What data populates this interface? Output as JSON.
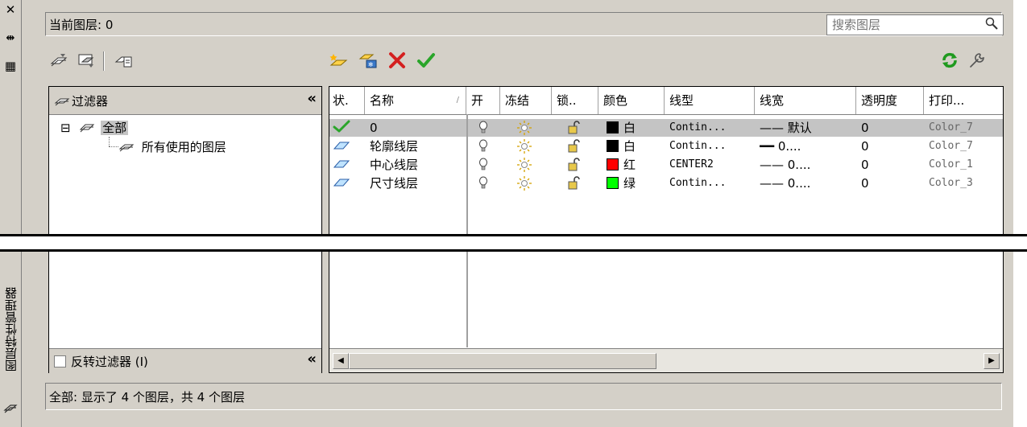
{
  "window": {
    "vertical_title": "图层特性管理器",
    "close_glyph": "✕",
    "autohide_glyph": "⇹",
    "props_glyph": "▦"
  },
  "current_layer": {
    "label": "当前图层: 0"
  },
  "search": {
    "placeholder": "搜索图层"
  },
  "filter_pane": {
    "header": "过滤器",
    "collapse_glyph": "«",
    "tree": [
      {
        "label": "全部",
        "expander": "⊟",
        "selected": true
      },
      {
        "label": "所有使用的图层"
      }
    ],
    "invert_label": "反转过滤器 (I)"
  },
  "table": {
    "columns": [
      "状.",
      "名称",
      "开",
      "冻结",
      "锁..",
      "颜色",
      "线型",
      "线宽",
      "透明度",
      "打印..."
    ],
    "rows": [
      {
        "status": "current",
        "name": "0",
        "color_name": "白",
        "color_hex": "#000000",
        "linetype": "Contin...",
        "lineweight": "—— 默认",
        "transparency": "0",
        "plot_style": "Color_7",
        "selected": true
      },
      {
        "status": "layer",
        "name": "轮廓线层",
        "color_name": "白",
        "color_hex": "#000000",
        "linetype": "Contin...",
        "lineweight": "━━ 0....",
        "transparency": "0",
        "plot_style": "Color_7"
      },
      {
        "status": "layer",
        "name": "中心线层",
        "color_name": "红",
        "color_hex": "#ff0000",
        "linetype": "CENTER2",
        "lineweight": "—— 0....",
        "transparency": "0",
        "plot_style": "Color_1"
      },
      {
        "status": "layer",
        "name": "尺寸线层",
        "color_name": "绿",
        "color_hex": "#00ff00",
        "linetype": "Contin...",
        "lineweight": "—— 0....",
        "transparency": "0",
        "plot_style": "Color_3"
      }
    ]
  },
  "status_text": "全部: 显示了 4 个图层，共 4 个图层",
  "icons": {
    "new_filter": "new-property-filter-icon",
    "new_group": "new-group-filter-icon",
    "state_manager": "layer-states-manager-icon",
    "new_layer": "new-layer-icon",
    "new_vp_frozen": "new-layer-vp-frozen-icon",
    "delete_layer": "delete-layer-icon",
    "set_current": "set-current-icon",
    "refresh": "refresh-icon",
    "settings": "settings-wrench-icon"
  },
  "colors": {
    "accent_check": "#2aa52a",
    "delete_red": "#d42020",
    "refresh_green": "#1f9a1f"
  }
}
